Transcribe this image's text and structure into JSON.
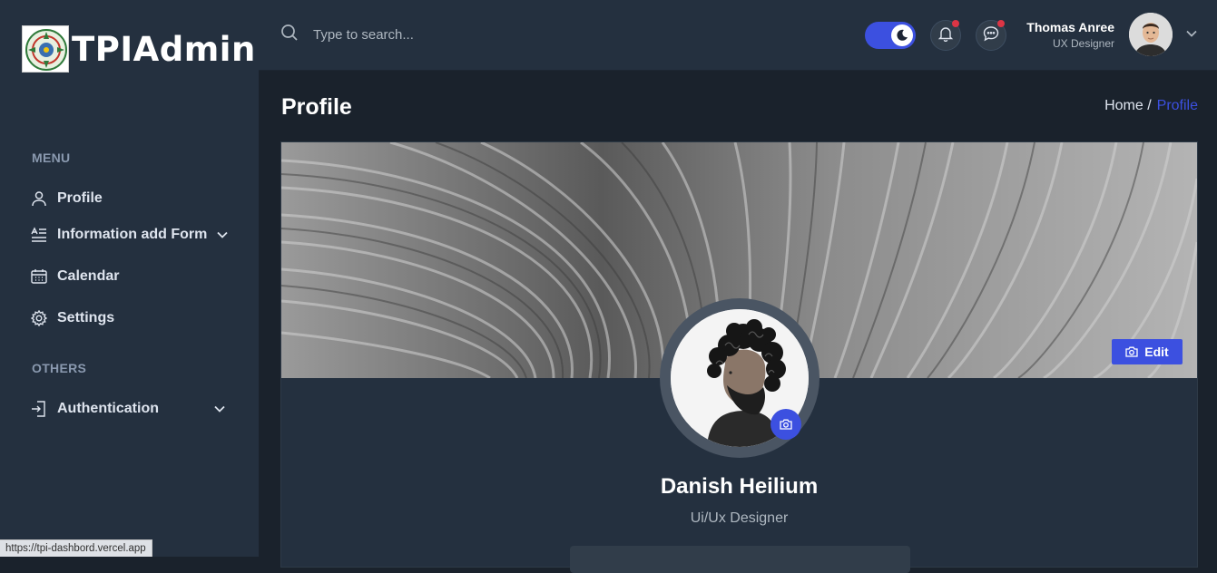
{
  "brand": {
    "title": "TPIAdmin"
  },
  "sidebar": {
    "groups": [
      {
        "label": "MENU"
      },
      {
        "label": "OTHERS"
      }
    ],
    "items": [
      {
        "label": "Profile",
        "icon": "user-icon"
      },
      {
        "label": "Information add Form",
        "icon": "form-icon",
        "has_dropdown": true
      },
      {
        "label": "Calendar",
        "icon": "calendar-icon"
      },
      {
        "label": "Settings",
        "icon": "gear-icon"
      },
      {
        "label": "Authentication",
        "icon": "login-icon",
        "has_dropdown": true
      }
    ]
  },
  "header": {
    "search": {
      "placeholder": "Type to search..."
    },
    "dark_mode": true,
    "notifications_unread": true,
    "messages_unread": true,
    "user": {
      "name": "Thomas Anree",
      "role": "UX Designer"
    }
  },
  "page": {
    "title": "Profile",
    "breadcrumb": {
      "home": "Home /",
      "current": "Profile"
    }
  },
  "profile": {
    "cover_edit_label": "Edit",
    "name": "Danish Heilium",
    "role": "Ui/Ux Designer"
  },
  "status": {
    "url": "https://tpi-dashbord.vercel.app"
  },
  "colors": {
    "accent": "#3c50e0",
    "sidebar_bg": "#24303f",
    "page_bg": "#1a222c",
    "alert_dot": "#dc3545"
  }
}
